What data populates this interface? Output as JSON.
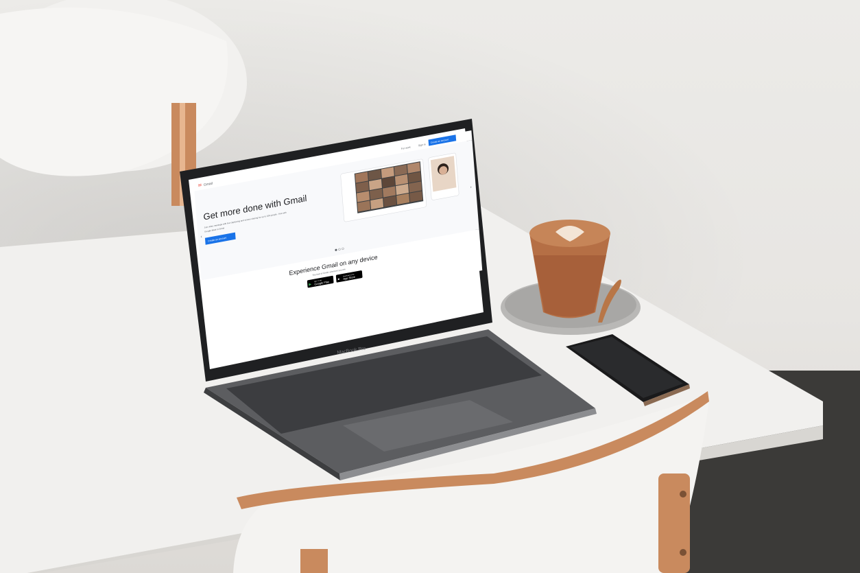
{
  "gmail": {
    "logo_text": "Gmail",
    "nav": {
      "for_work": "For work",
      "sign_in": "Sign in",
      "create_account": "Create an account"
    },
    "hero": {
      "title": "Get more done with Gmail",
      "subtitle_line1": "Join video meetings with live captioning and screen sharing for up to 100 people - free with",
      "subtitle_line2": "Google Meet in Gmail",
      "cta": "Create an account"
    },
    "carousel": {
      "total": 3,
      "active": 1
    },
    "device_section": {
      "title": "Experience Gmail on any device",
      "subtitle": "The best of Gmail, wherever you are.",
      "google_play_small": "GET IT ON",
      "google_play_big": "Google Play",
      "app_store_small": "Download on the",
      "app_store_big": "App Store"
    }
  },
  "laptop": {
    "brand": "MacBook Pro"
  },
  "colors": {
    "gmail_blue": "#1a73e8",
    "gmail_red": "#ea4335",
    "laptop_body": "#5e5f61",
    "coffee": "#b56f45",
    "wood": "#c98a5e"
  }
}
